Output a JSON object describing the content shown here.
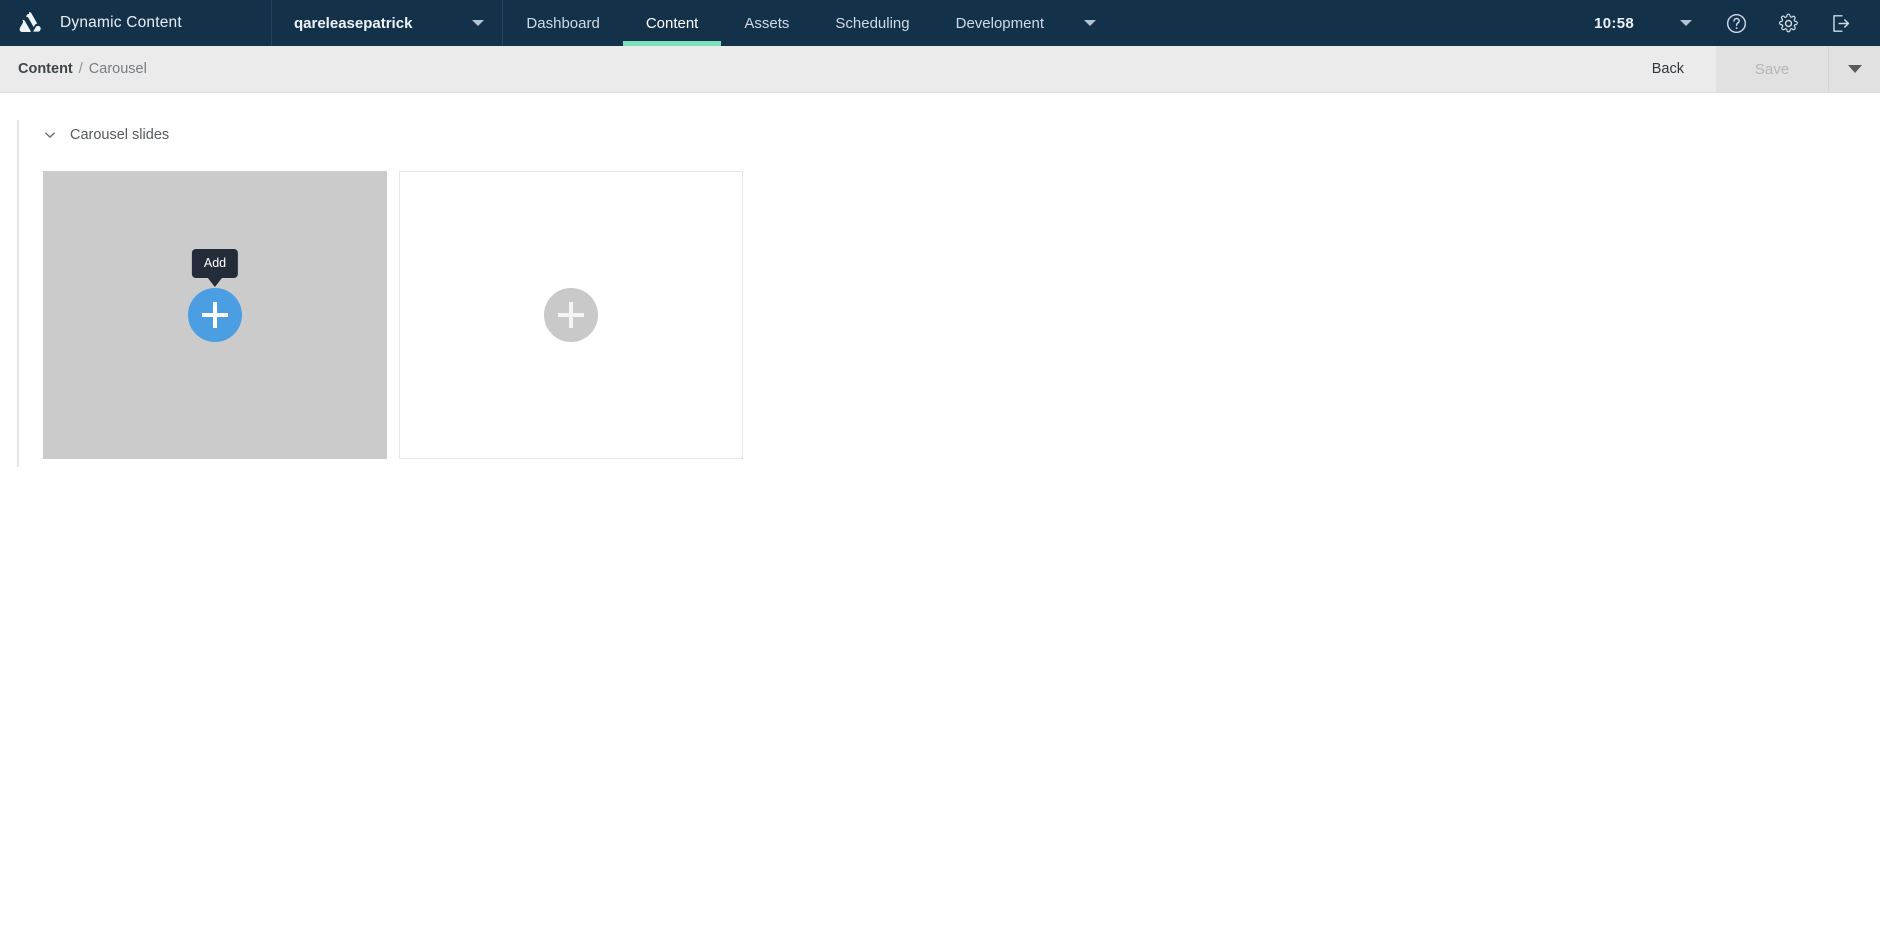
{
  "topbar": {
    "logo_icon": "amplience-logo-icon",
    "product_title": "Dynamic Content",
    "account": {
      "name": "qareleasepatrick",
      "caret_icon": "chevron-down-icon"
    },
    "tabs": [
      {
        "label": "Dashboard",
        "active": false
      },
      {
        "label": "Content",
        "active": true
      },
      {
        "label": "Assets",
        "active": false
      },
      {
        "label": "Scheduling",
        "active": false
      },
      {
        "label": "Development",
        "active": false
      }
    ],
    "nav_more_caret_icon": "chevron-down-icon",
    "clock": "10:58",
    "clock_caret_icon": "chevron-down-icon",
    "help_icon": "question-circle-icon",
    "settings_icon": "gear-icon",
    "logout_icon": "sign-out-icon"
  },
  "subbar": {
    "breadcrumb": {
      "root": "Content",
      "separator": "/",
      "leaf": "Carousel"
    },
    "back_label": "Back",
    "save_label": "Save",
    "save_disabled": true,
    "save_caret_icon": "chevron-down-icon"
  },
  "main": {
    "group": {
      "collapse_icon": "chevron-down-icon",
      "title": "Carousel slides",
      "expanded": true
    },
    "slides": [
      {
        "state": "hovered",
        "add_icon": "plus-icon",
        "tooltip": "Add"
      },
      {
        "state": "empty",
        "add_icon": "plus-icon"
      }
    ]
  },
  "colors": {
    "nav_background": "#14314a",
    "active_tab_underline": "#7ee0bb",
    "subbar_background": "#ebebeb",
    "add_button_active": "#4a9ee1",
    "add_button_idle": "#c9c9c9",
    "slide_filled_background": "#cbcbcb",
    "tooltip_background": "#232c38"
  }
}
